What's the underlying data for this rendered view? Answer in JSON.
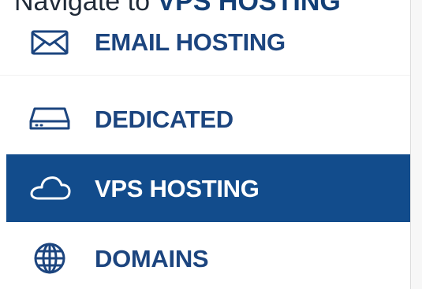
{
  "instruction": {
    "prefix": "Navigate to ",
    "target": "VPS HOSTING"
  },
  "menu": {
    "items": [
      {
        "label": "EMAIL HOSTING",
        "icon": "envelope-icon",
        "active": false
      },
      {
        "label": "DEDICATED",
        "icon": "server-drive-icon",
        "active": false
      },
      {
        "label": "VPS HOSTING",
        "icon": "cloud-icon",
        "active": true
      },
      {
        "label": "DOMAINS",
        "icon": "globe-icon",
        "active": false
      }
    ]
  },
  "colors": {
    "brand_blue": "#124c8c",
    "text_blue": "#1c457f",
    "active_text": "#ffffff"
  }
}
